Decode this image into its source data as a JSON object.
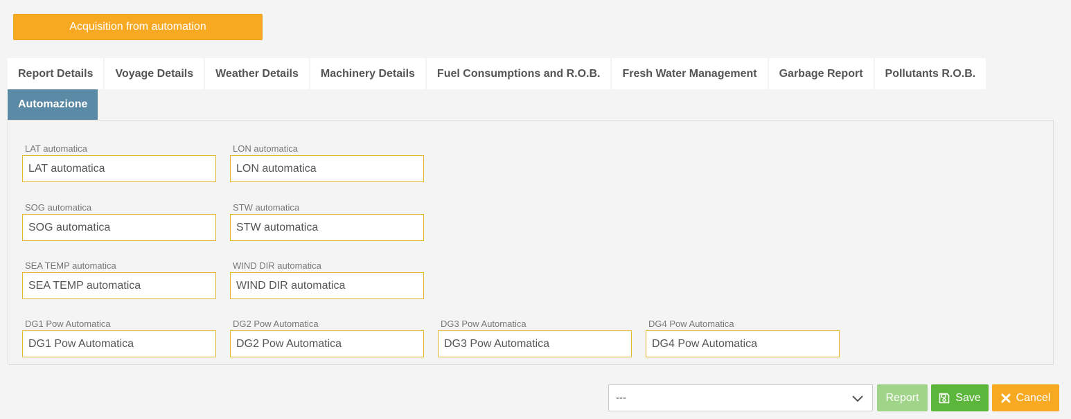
{
  "acquisition_button": {
    "label": "Acquisition from automation"
  },
  "tabs_row1": [
    {
      "label": "Report Details"
    },
    {
      "label": "Voyage Details"
    },
    {
      "label": "Weather Details"
    },
    {
      "label": "Machinery Details"
    },
    {
      "label": "Fuel Consumptions and R.O.B."
    },
    {
      "label": "Fresh Water Management"
    },
    {
      "label": "Garbage Report"
    },
    {
      "label": "Pollutants R.O.B."
    }
  ],
  "tabs_row2": [
    {
      "label": "Automazione",
      "active": true
    }
  ],
  "fields": {
    "lat": {
      "label": "LAT automatica",
      "placeholder": "LAT automatica"
    },
    "lon": {
      "label": "LON automatica",
      "placeholder": "LON automatica"
    },
    "sog": {
      "label": "SOG automatica",
      "placeholder": "SOG automatica"
    },
    "stw": {
      "label": "STW automatica",
      "placeholder": "STW automatica"
    },
    "sea_temp": {
      "label": "SEA TEMP automatica",
      "placeholder": "SEA TEMP automatica"
    },
    "wind_dir": {
      "label": "WIND DIR automatica",
      "placeholder": "WIND DIR automatica"
    },
    "dg1": {
      "label": "DG1 Pow Automatica",
      "placeholder": "DG1 Pow Automatica"
    },
    "dg2": {
      "label": "DG2 Pow Automatica",
      "placeholder": "DG2 Pow Automatica"
    },
    "dg3": {
      "label": "DG3 Pow Automatica",
      "placeholder": "DG3 Pow Automatica"
    },
    "dg4": {
      "label": "DG4 Pow Automatica",
      "placeholder": "DG4 Pow Automatica"
    }
  },
  "actions": {
    "select_value": "---",
    "report_label": "Report",
    "save_label": "Save",
    "cancel_label": "Cancel"
  },
  "colors": {
    "accent_orange": "#f7a922",
    "active_tab": "#5b8aa6",
    "save_green": "#5cb63b",
    "report_green_disabled": "#a0d488",
    "input_border": "#e8b62c"
  },
  "icons": {
    "save": "floppy-disk-icon",
    "cancel": "close-icon",
    "select": "chevron-down-icon"
  }
}
